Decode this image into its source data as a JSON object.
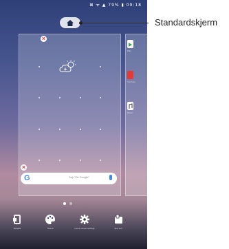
{
  "status_bar": {
    "icons_text": "⊠ ᯤ ▲ 79% ▮ 09:18"
  },
  "home_screen": {
    "home_button_icon": "home-icon",
    "delete_badge_icon": "close-icon",
    "weather_widget_icon": "weather-sun-cloud-icon",
    "search_widget": {
      "logo": "G",
      "hint": "Say \"Ok Google\"",
      "mic_icon": "mic-icon"
    },
    "side_apps": [
      {
        "icon": "play-store-icon",
        "color": "#34a853",
        "label": "Play"
      },
      {
        "icon": "youtube-icon",
        "color": "#e53935",
        "label": "YouTube"
      },
      {
        "icon": "music-icon",
        "color": "#ffffff",
        "label": "Music"
      }
    ],
    "page_indicator": {
      "pages": 2,
      "current": 1
    }
  },
  "tools": [
    {
      "icon": "widgets-icon",
      "label": "Widgets"
    },
    {
      "icon": "palette-icon",
      "label": "Theme"
    },
    {
      "icon": "gear-icon",
      "label": "Home screen settings"
    },
    {
      "icon": "app-sort-icon",
      "label": "App sort"
    }
  ],
  "callout": {
    "label": "Standardskjerm"
  }
}
